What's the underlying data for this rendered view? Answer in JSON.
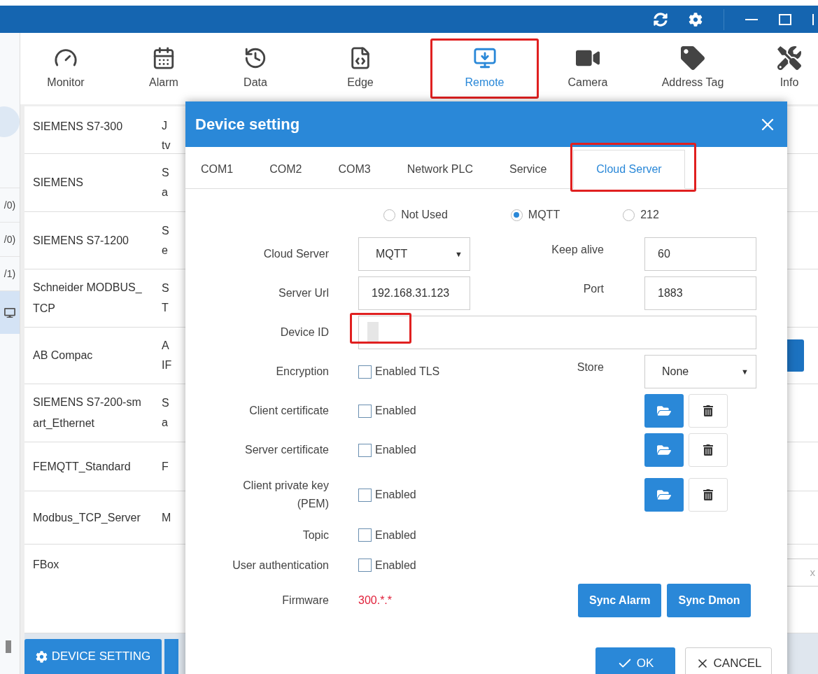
{
  "toolbar": [
    {
      "label": "Monitor",
      "selected": false,
      "highlighted": false
    },
    {
      "label": "Alarm",
      "selected": false,
      "highlighted": false
    },
    {
      "label": "Data",
      "selected": false,
      "highlighted": false
    },
    {
      "label": "Edge",
      "selected": false,
      "highlighted": false
    },
    {
      "label": "Remote",
      "selected": true,
      "highlighted": true
    },
    {
      "label": "Camera",
      "selected": false,
      "highlighted": false
    },
    {
      "label": "Address Tag",
      "selected": false,
      "highlighted": false
    },
    {
      "label": "Info",
      "selected": false,
      "highlighted": false
    }
  ],
  "sidebar": {
    "items": [
      {
        "label": "/0)",
        "selected": false
      },
      {
        "label": "/0)",
        "selected": false
      },
      {
        "label": "/1)",
        "selected": false
      },
      {
        "selected": true
      }
    ]
  },
  "table": {
    "rows": [
      {
        "name": "SIEMENS S7-300",
        "column_2": [
          "J",
          "tv"
        ]
      },
      {
        "name": "SIEMENS",
        "column_2": [
          "S",
          "a"
        ]
      },
      {
        "name": "SIEMENS S7-1200",
        "column_2": [
          "S",
          "e"
        ]
      },
      {
        "name": "Schneider MODBUS_\nTCP",
        "column_2": [
          "S",
          "T"
        ]
      },
      {
        "name": "AB Compac",
        "column_2": [
          "A",
          "IF"
        ],
        "trailing_button": true
      },
      {
        "name": "SIEMENS S7-200-sm\nart_Ethernet",
        "column_2": [
          "S",
          "a"
        ]
      },
      {
        "name": "FEMQTT_Standard",
        "column_2": [
          "F"
        ]
      },
      {
        "name": "Modbus_TCP_Server",
        "column_2": [
          "M"
        ]
      },
      {
        "name": "FBox",
        "trailing_field": "x"
      }
    ]
  },
  "bottom_bar": {
    "buttons": [
      "DEVICE SETTING"
    ]
  },
  "dialog": {
    "title": "Device setting",
    "tabs": [
      {
        "label": "COM1",
        "selected": false,
        "highlighted": false
      },
      {
        "label": "COM2",
        "selected": false,
        "highlighted": false
      },
      {
        "label": "COM3",
        "selected": false,
        "highlighted": false
      },
      {
        "label": "Network PLC",
        "selected": false,
        "highlighted": false
      },
      {
        "label": "Service",
        "selected": false,
        "highlighted": false
      },
      {
        "label": "Cloud Server",
        "selected": true,
        "highlighted": true
      }
    ],
    "mode": [
      {
        "label": "Not Used",
        "selected": false
      },
      {
        "label": "MQTT",
        "selected": true
      },
      {
        "label": "212",
        "selected": false
      }
    ],
    "rows": [
      {
        "label": "Cloud Server",
        "field": {
          "kind": "select",
          "value": "MQTT",
          "caret": "▼"
        },
        "right": {
          "label": "Keep alive",
          "field": {
            "kind": "input",
            "value": "60"
          }
        }
      },
      {
        "label": "Server Url",
        "field": {
          "kind": "input",
          "value": "192.168.31.123"
        },
        "right": {
          "label": "Port",
          "field": {
            "kind": "input",
            "value": "1883"
          }
        }
      },
      {
        "label": "Device ID",
        "field": {
          "kind": "wide-input",
          "highlighted": true
        }
      },
      {
        "label": "Encryption",
        "field": {
          "kind": "checkbox",
          "text": "Enabled TLS",
          "checked": false
        },
        "right": {
          "label": "Store",
          "field": {
            "kind": "select",
            "value": "None",
            "caret": "▼"
          }
        }
      },
      {
        "label": "Client certificate",
        "field": {
          "kind": "checkbox",
          "text": "Enabled",
          "checked": false
        },
        "file_buttons": true
      },
      {
        "label": "Server certificate",
        "field": {
          "kind": "checkbox",
          "text": "Enabled",
          "checked": false
        },
        "file_buttons": true
      },
      {
        "label": "Client private key\n(PEM)",
        "field": {
          "kind": "checkbox",
          "text": "Enabled",
          "checked": false
        },
        "file_buttons": true
      },
      {
        "label": "Topic",
        "field": {
          "kind": "checkbox",
          "text": "Enabled",
          "checked": false
        }
      },
      {
        "label": "User authentication",
        "field": {
          "kind": "checkbox",
          "text": "Enabled",
          "checked": false
        }
      },
      {
        "label": "Firmware",
        "field": {
          "kind": "text",
          "value": "300.*.*"
        },
        "buttons": [
          "Sync Alarm",
          "Sync Dmon"
        ]
      }
    ],
    "footer": [
      {
        "kind": "ok",
        "label": "OK"
      },
      {
        "kind": "cancel",
        "label": "CANCEL"
      }
    ]
  }
}
